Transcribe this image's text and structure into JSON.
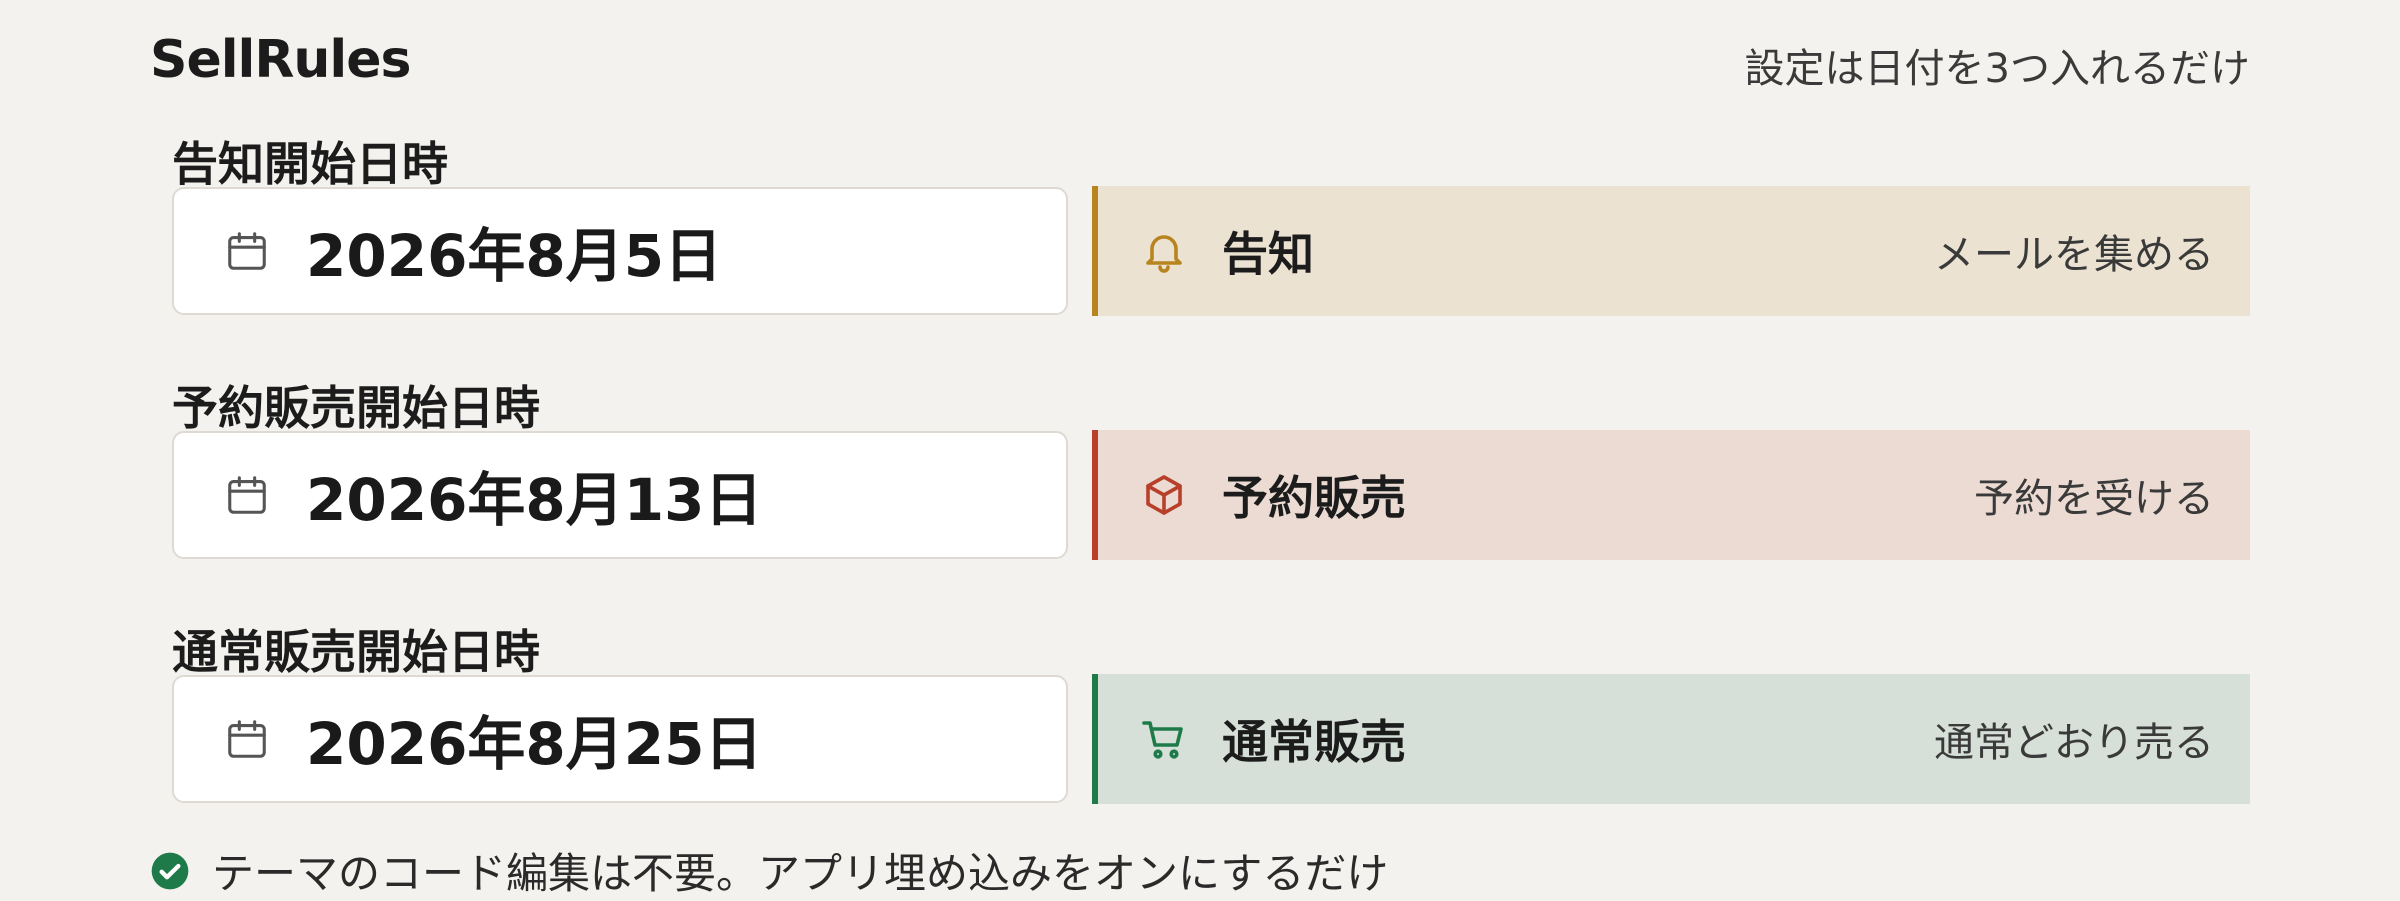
{
  "header": {
    "brand": "SellRules",
    "tagline": "設定は日付を3つ入れるだけ"
  },
  "rows": [
    {
      "label": "告知開始日時",
      "date": "2026年8月5日",
      "phase": {
        "title": "告知",
        "description": "メールを集める",
        "icon": "bell-icon",
        "accent": "#b8841f",
        "background": "#ebe2d2"
      }
    },
    {
      "label": "予約販売開始日時",
      "date": "2026年8月13日",
      "phase": {
        "title": "予約販売",
        "description": "予約を受ける",
        "icon": "box-icon",
        "accent": "#b8402a",
        "background": "#ebdbd3"
      }
    },
    {
      "label": "通常販売開始日時",
      "date": "2026年8月25日",
      "phase": {
        "title": "通常販売",
        "description": "通常どおり売る",
        "icon": "cart-icon",
        "accent": "#1f7a4a",
        "background": "#d6e0d8"
      }
    }
  ],
  "footer": {
    "note": "テーマのコード編集は不要。アプリ埋め込みをオンにするだけ",
    "icon": "check-circle-icon",
    "icon_color": "#1f7a4a"
  }
}
